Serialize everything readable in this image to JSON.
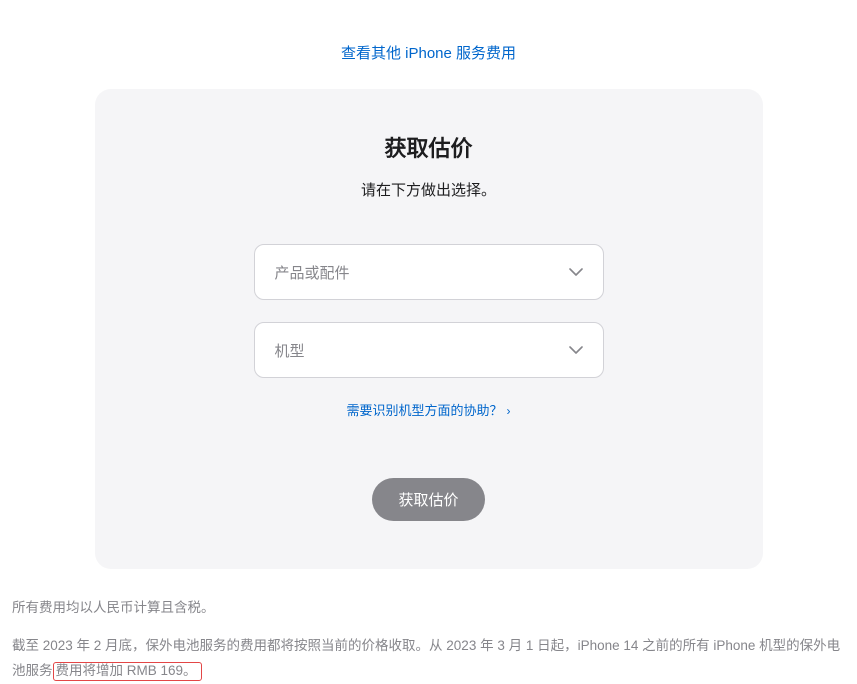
{
  "topLink": {
    "label": "查看其他 iPhone 服务费用"
  },
  "card": {
    "title": "获取估价",
    "subtitle": "请在下方做出选择。",
    "select1": {
      "placeholder": "产品或配件"
    },
    "select2": {
      "placeholder": "机型"
    },
    "helpLink": {
      "label": "需要识别机型方面的协助？"
    },
    "submitButton": {
      "label": "获取估价"
    }
  },
  "footer": {
    "line1": "所有费用均以人民币计算且含税。",
    "line2_part1": "截至 2023 年 2 月底，保外电池服务的费用都将按照当前的价格收取。从 2023 年 3 月 1 日起，iPhone 14 之前的所有 iPhone 机型的保外电池服务",
    "line2_highlight": "费用将增加 RMB 169。"
  }
}
